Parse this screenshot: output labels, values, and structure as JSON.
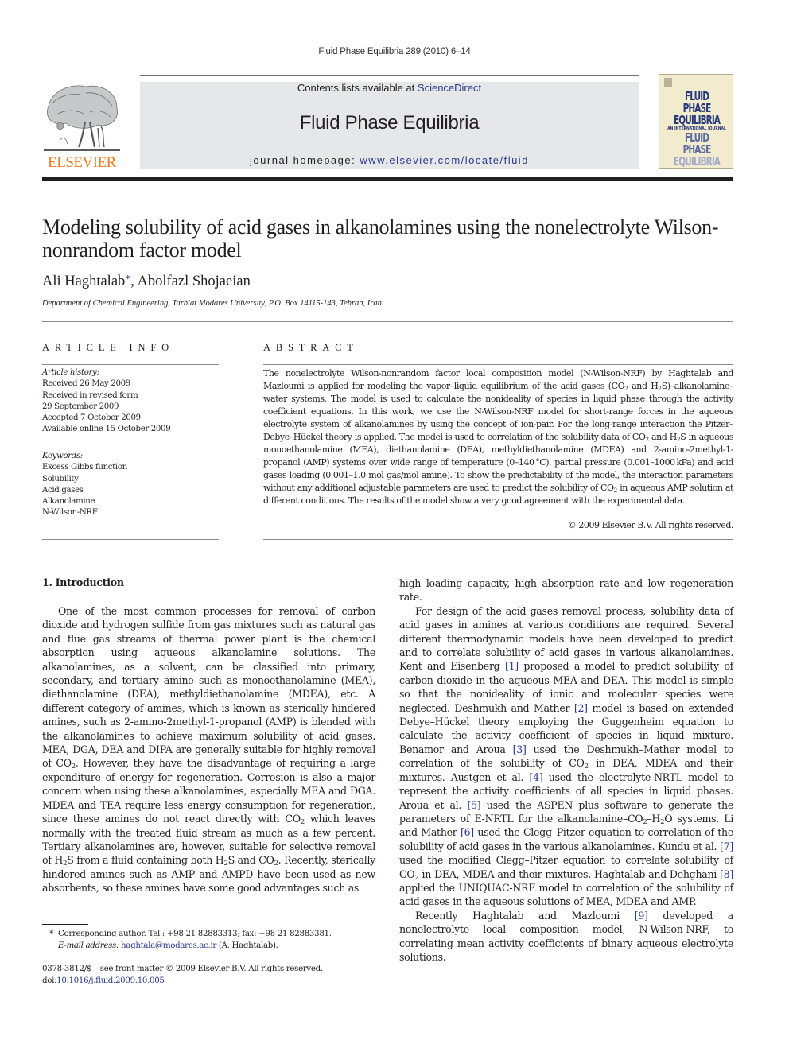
{
  "running_head": "Fluid Phase Equilibria 289 (2010) 6–14",
  "masthead": {
    "publisher_logo_text": "ELSEVIER",
    "contents_prefix": "Contents lists available at ",
    "contents_link": "ScienceDirect",
    "journal_title": "Fluid Phase Equilibria",
    "homepage_prefix": "journal homepage: ",
    "homepage_link": "www.elsevier.com/locate/fluid",
    "cover": {
      "line1": "FLUID PHASE",
      "line2": "EQUILIBRIA",
      "line3": "AN INTERNATIONAL JOURNAL",
      "line4": "FLUID PHASE",
      "line5": "EQUILIBRIA"
    },
    "colors": {
      "elsevier_orange": "#f47920",
      "link_blue": "#2b3990",
      "masthead_gray": "#e6e7e8"
    }
  },
  "article": {
    "title": "Modeling solubility of acid gases in alkanolamines using the nonelectrolyte Wilson-nonrandom factor model",
    "authors": {
      "first": "Ali Haghtalab",
      "corresponding_mark": "*",
      "separator": ", ",
      "second": "Abolfazl Shojaeian"
    },
    "affiliation": "Department of Chemical Engineering, Tarbiat Modares University, P.O. Box 14115-143, Tehran, Iran"
  },
  "article_info": {
    "heading": "ARTICLE INFO",
    "history_label": "Article history:",
    "history": [
      "Received 26 May 2009",
      "Received in revised form",
      "29 September 2009",
      "Accepted 7 October 2009",
      "Available online 15 October 2009"
    ],
    "keywords_label": "Keywords:",
    "keywords": [
      "Excess Gibbs function",
      "Solubility",
      "Acid gases",
      "Alkanolamine",
      "N-Wilson-NRF"
    ]
  },
  "abstract": {
    "heading": "ABSTRACT",
    "t1": "The nonelectrolyte Wilson-nonrandom factor local composition model (N-Wilson-NRF) by Haghtalab and Mazloumi is applied for modeling the vapor–liquid equilibrium of the acid gases (CO",
    "t2": " and H",
    "t3": "S)–alkanolamine–water systems. The model is used to calculate the nonideality of species in liquid phase through the activity coefficient equations. In this work, we use the N-Wilson-NRF model for short-range forces in the aqueous electrolyte system of alkanolamines by using the concept of ion-pair. For the long-range interaction the Pitzer–Debye–Hückel theory is applied. The model is used to correlation of the solubility data of CO",
    "t4": " and H",
    "t5": "S in aqueous monoethanolamine (MEA), diethanolamine (DEA), methyldiethanolamine (MDEA) and 2-amino-2methyl-1-propanol (AMP) systems over wide range of temperature (0–140 °C), partial pressure (0.001–1000 kPa) and acid gases loading (0.001–1.0 mol gas/mol amine). To show the predictability of the model, the interaction parameters without any additional adjustable parameters are used to predict the solubility of CO",
    "t6": " in aqueous AMP solution at different conditions. The results of the model show a very good agreement with the experimental data.",
    "sub2": "2",
    "copyright": "© 2009 Elsevier B.V. All rights reserved."
  },
  "introduction": {
    "heading": "1.  Introduction",
    "left_p1_a": "One of the most common processes for removal of carbon dioxide and hydrogen sulfide from gas mixtures such as natural gas and flue gas streams of thermal power plant is the chemical absorption using aqueous alkanolamine solutions. The alkanolamines, as a solvent, can be classified into primary, secondary, and tertiary amine such as monoethanolamine (MEA), diethanolamine (DEA), methyldiethanolamine (MDEA), etc. A different category of amines, which is known as sterically hindered amines, such as 2-amino-2methyl-1-propanol (AMP) is blended with the alkanolamines to achieve maximum solubility of acid gases. MEA, DGA, DEA and DIPA are generally suitable for highly removal of CO",
    "left_p1_b": ". However, they have the disadvantage of requiring a large expenditure of energy for regeneration. Corrosion is also a major concern when using these alkanolamines, especially MEA and DGA. MDEA and TEA require less energy consumption for regeneration, since these amines do not react directly with CO",
    "left_p1_c": " which leaves normally with the treated fluid stream as much as a few percent. Tertiary alkanolamines are, however, suitable for selective removal of H",
    "left_p1_d": "S from a fluid containing both H",
    "left_p1_e": "S and CO",
    "left_p1_f": ". Recently, sterically hindered amines such as AMP and AMPD have been used as new absorbents, so these amines have some good advantages such as",
    "right_cont": "high loading capacity, high absorption rate and low regeneration rate.",
    "right_p2_a": "For design of the acid gases removal process, solubility data of acid gases in amines at various conditions are required. Several different thermodynamic models have been developed to predict and to correlate solubility of acid gases in various alkanolamines. Kent and Eisenberg ",
    "ref1": "[1]",
    "right_p2_b": " proposed a model to predict solubility of carbon dioxide in the aqueous MEA and DEA. This model is simple so that the nonideality of ionic and molecular species were neglected. Deshmukh and Mather ",
    "ref2": "[2]",
    "right_p2_c": " model is based on extended Debye–Hückel theory employing the Guggenheim equation to calculate the activity coefficient of species in liquid mixture. Benamor and Aroua ",
    "ref3": "[3]",
    "right_p2_d": " used the Deshmukh–Mather model to correlation of the solubility of CO",
    "right_p2_e": " in DEA, MDEA and their mixtures. Austgen et al. ",
    "ref4": "[4]",
    "right_p2_f": " used the electrolyte-NRTL model to represent the activity coefficients of all species in liquid phases. Aroua et al. ",
    "ref5": "[5]",
    "right_p2_g": " used the ASPEN plus software to generate the parameters of E-NRTL for the alkanolamine–CO",
    "right_p2_h": "–H",
    "right_p2_i": "O systems. Li and Mather ",
    "ref6": "[6]",
    "right_p2_j": " used the Clegg–Pitzer equation to correlation of the solubility of acid gases in the various alkanolamines. Kundu et al. ",
    "ref7": "[7]",
    "right_p2_k": " used the modified Clegg–Pitzer equation to correlate solubility of CO",
    "right_p2_l": " in DEA, MDEA and their mixtures. Haghtalab and Dehghani ",
    "ref8": "[8]",
    "right_p2_m": " applied the UNIQUAC-NRF model to correlation of the solubility of acid gases in the aqueous solutions of MEA, MDEA and AMP.",
    "right_p3_a": "Recently Haghtalab and Mazloumi ",
    "ref9": "[9]",
    "right_p3_b": " developed a nonelectrolyte local composition model, N-Wilson-NRF, to correlating mean activity coefficients of binary aqueous electrolyte solutions.",
    "sub2": "2"
  },
  "footnote": {
    "star": "*",
    "corresponding": "Corresponding author. Tel.: +98 21 82883313; fax: +98 21 82883381.",
    "email_label": "E-mail address:",
    "email": "haghtala@modares.ac.ir",
    "email_suffix": " (A. Haghtalab)."
  },
  "front_matter": {
    "issn_line": "0378-3812/$ – see front matter © 2009 Elsevier B.V. All rights reserved.",
    "doi_prefix": "doi:",
    "doi": "10.1016/j.fluid.2009.10.005"
  }
}
